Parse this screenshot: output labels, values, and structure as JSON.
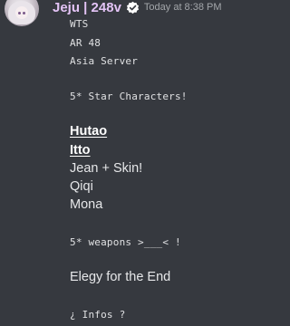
{
  "message": {
    "username": "Jeju | 248v",
    "timestamp": "Today at 8:38 PM",
    "lines": [
      "WTS",
      "AR 48",
      "Asia Server",
      "5* Star Characters!",
      "Hutao",
      "Itto",
      "Jean + Skin!",
      "Qiqi",
      "Mona",
      "5* weapons >___< !",
      "Elegy for the End",
      "¿ Infos ?"
    ]
  },
  "icons": {
    "verified": "verified-badge-icon",
    "avatar": "user-avatar"
  },
  "colors": {
    "background": "#36393f",
    "username": "#e3c3f5",
    "timestamp": "#a3a6aa",
    "text": "#e6e7e9"
  }
}
